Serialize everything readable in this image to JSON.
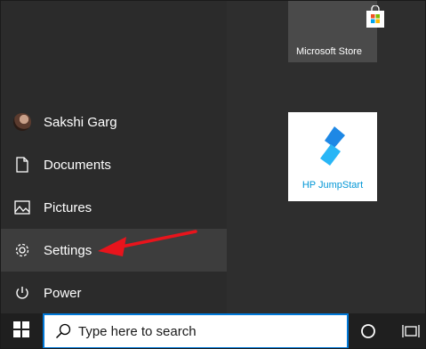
{
  "start_menu": {
    "user": {
      "name": "Sakshi Garg",
      "icon": "avatar"
    },
    "items": [
      {
        "label": "Documents",
        "icon": "document-icon"
      },
      {
        "label": "Pictures",
        "icon": "pictures-icon"
      },
      {
        "label": "Settings",
        "icon": "gear-icon"
      },
      {
        "label": "Power",
        "icon": "power-icon"
      }
    ]
  },
  "tiles": {
    "store": {
      "label": "Microsoft Store",
      "icon": "store-bag-icon"
    },
    "hp": {
      "label": "HP JumpStart",
      "icon": "hp-jumpstart-logo"
    }
  },
  "taskbar": {
    "search_placeholder": "Type here to search",
    "icons": [
      "windows-logo-icon",
      "search-icon",
      "cortana-icon",
      "task-view-icon"
    ]
  },
  "colors": {
    "menu_bg": "#2b2b2b",
    "active_item_bg": "#3d3d3d",
    "taskbar_bg": "#1f1f1f",
    "search_border": "#0078d7",
    "annotation_arrow": "#e8141c",
    "hp_blue": "#0096d6"
  }
}
